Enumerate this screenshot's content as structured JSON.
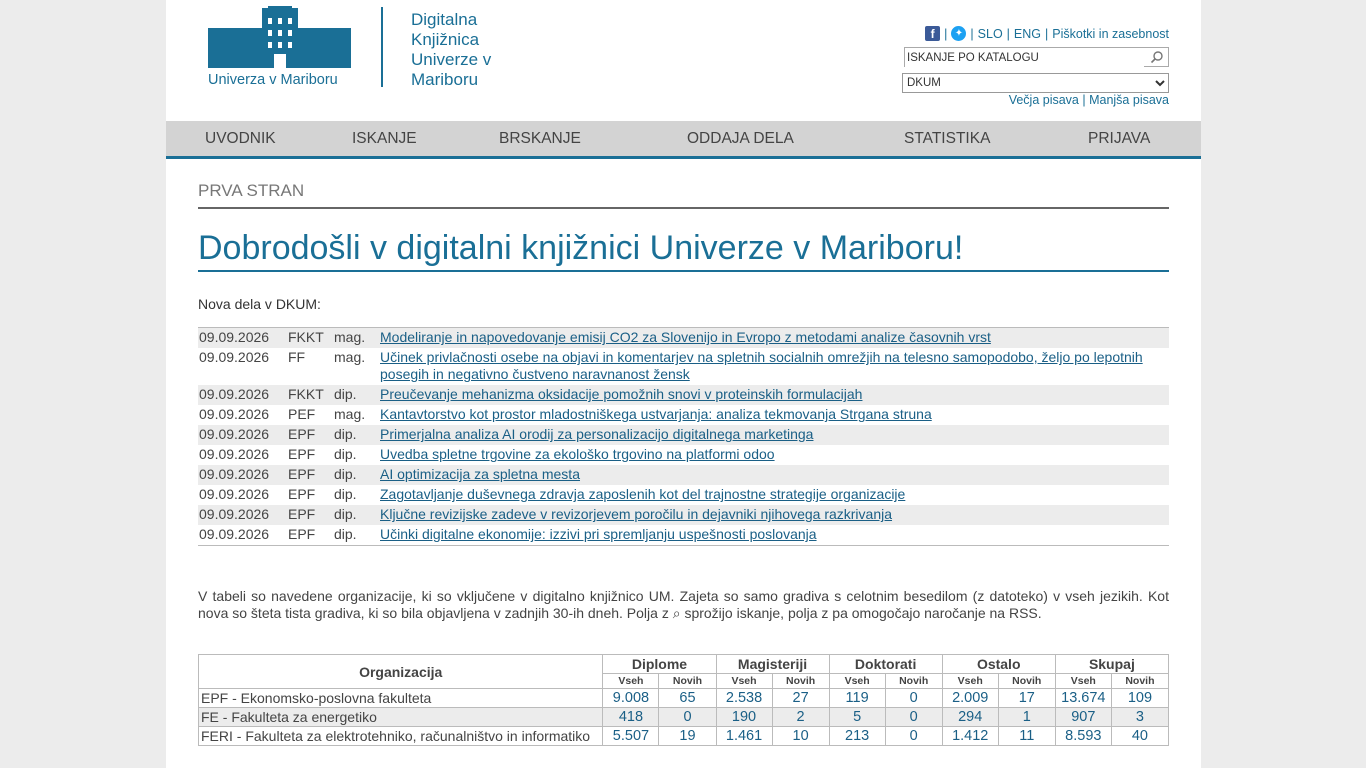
{
  "header": {
    "logo_um_text": "Univerza v Mariboru",
    "logo_dk_lines": [
      "Digitalna",
      "Knjižnica",
      "Univerze v",
      "Mariboru"
    ],
    "toplinks": {
      "slo": "SLO",
      "eng": "ENG",
      "cookies": "Piškotki in zasebnost"
    },
    "search_placeholder": "ISKANJE PO KATALOGU",
    "search_value": "ISKANJE PO KATALOGU",
    "select_value": "DKUM",
    "font_larger": "Večja pisava",
    "font_smaller": "Manjša pisava"
  },
  "nav": [
    "UVODNIK",
    "ISKANJE",
    "BRSKANJE",
    "ODDAJA DELA",
    "STATISTIKA",
    "PRIJAVA"
  ],
  "breadcrumb": "PRVA STRAN",
  "title": "Dobrodošli v digitalni knjižnici Univerze v Mariboru!",
  "nova_label": "Nova dela v DKUM:",
  "news": [
    {
      "date": "09.09.2026",
      "org": "FKKT",
      "type": "mag.",
      "title": "Modeliranje in napovedovanje emisij CO2 za Slovenijo in Evropo z metodami analize časovnih vrst"
    },
    {
      "date": "09.09.2026",
      "org": "FF",
      "type": "mag.",
      "title": "Učinek privlačnosti osebe na objavi in komentarjev na spletnih socialnih omrežjih na telesno samopodobo, željo po lepotnih posegih in negativno čustveno naravnanost žensk"
    },
    {
      "date": "09.09.2026",
      "org": "FKKT",
      "type": "dip.",
      "title": "Preučevanje mehanizma oksidacije pomožnih snovi v proteinskih formulacijah"
    },
    {
      "date": "09.09.2026",
      "org": "PEF",
      "type": "mag.",
      "title": "Kantavtorstvo kot prostor mladostniškega ustvarjanja: analiza tekmovanja Strgana struna"
    },
    {
      "date": "09.09.2026",
      "org": "EPF",
      "type": "dip.",
      "title": "Primerjalna analiza AI orodij za personalizacijo digitalnega marketinga"
    },
    {
      "date": "09.09.2026",
      "org": "EPF",
      "type": "dip.",
      "title": "Uvedba spletne trgovine za ekološko trgovino na platformi odoo"
    },
    {
      "date": "09.09.2026",
      "org": "EPF",
      "type": "dip.",
      "title": "AI optimizacija za spletna mesta"
    },
    {
      "date": "09.09.2026",
      "org": "EPF",
      "type": "dip.",
      "title": "Zagotavljanje duševnega zdravja zaposlenih kot del trajnostne strategije organizacije"
    },
    {
      "date": "09.09.2026",
      "org": "EPF",
      "type": "dip.",
      "title": "Ključne revizijske zadeve v revizorjevem poročilu in dejavniki njihovega razkrivanja"
    },
    {
      "date": "09.09.2026",
      "org": "EPF",
      "type": "dip.",
      "title": "Učinki digitalne ekonomije: izzivi pri spremljanju uspešnosti poslovanja"
    }
  ],
  "description": "V tabeli so navedene organizacije, ki so vključene v digitalno knjižnico UM. Zajeta so samo gradiva s celotnim besedilom (z datoteko) v vseh jezikih. Kot nova so šteta tista gradiva, ki so bila objavljena v zadnjih 30-ih dneh. Polja z ⌕ sprožijo iskanje, polja z  pa omogočajo naročanje na RSS.",
  "org_table": {
    "col_org": "Organizacija",
    "groups": [
      "Diplome",
      "Magisteriji",
      "Doktorati",
      "Ostalo",
      "Skupaj"
    ],
    "sub_all": "Vseh",
    "sub_new": "Novih",
    "rows": [
      {
        "name": "EPF - Ekonomsko-poslovna fakulteta",
        "values": [
          "9.008",
          "65",
          "2.538",
          "27",
          "119",
          "0",
          "2.009",
          "17",
          "13.674",
          "109"
        ]
      },
      {
        "name": "FE - Fakulteta za energetiko",
        "values": [
          "418",
          "0",
          "190",
          "2",
          "5",
          "0",
          "294",
          "1",
          "907",
          "3"
        ]
      },
      {
        "name": "FERI - Fakulteta za elektrotehniko, računalništvo in informatiko",
        "values": [
          "5.507",
          "19",
          "1.461",
          "10",
          "213",
          "0",
          "1.412",
          "11",
          "8.593",
          "40"
        ]
      }
    ]
  }
}
